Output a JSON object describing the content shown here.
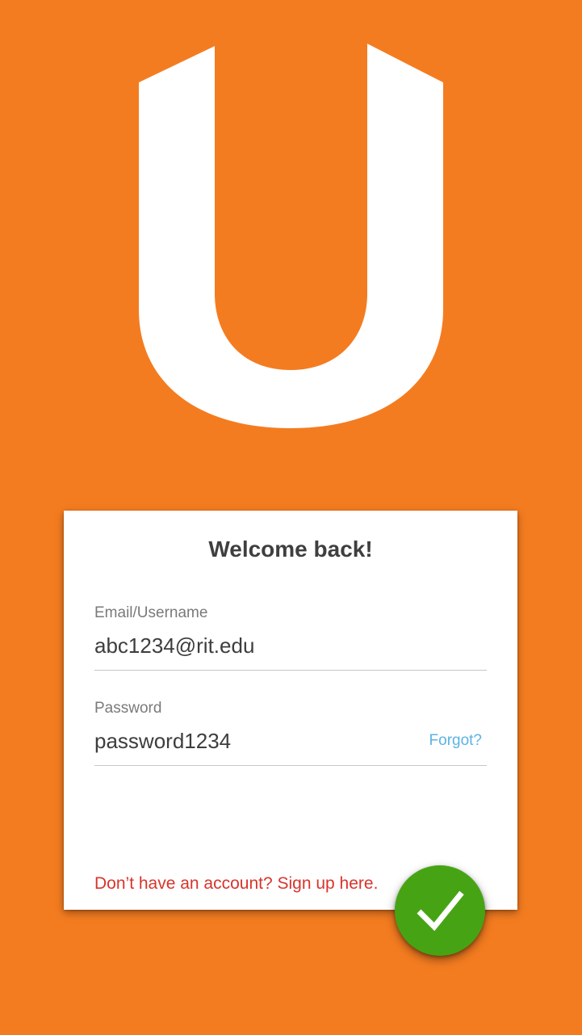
{
  "logo": {
    "name": "u-logo",
    "color": "#ffffff"
  },
  "colors": {
    "background": "#f47c20",
    "card": "#ffffff",
    "title": "#3f3f3f",
    "label": "#7a7a7a",
    "input_text": "#3d3d3d",
    "link_blue": "#5bb3e6",
    "link_red": "#d9342b",
    "fab": "#46a414"
  },
  "card": {
    "title": "Welcome back!",
    "email": {
      "label": "Email/Username",
      "value": "abc1234@rit.edu"
    },
    "password": {
      "label": "Password",
      "value": "password1234",
      "forgot_label": "Forgot?"
    },
    "signup_label": "Don’t have an account? Sign up here."
  },
  "submit": {
    "icon": "checkmark-icon"
  }
}
